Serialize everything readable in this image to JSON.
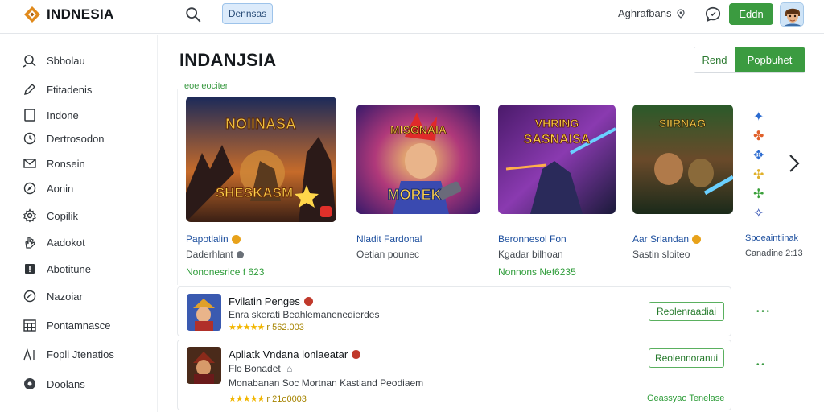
{
  "header": {
    "logo_text": "INDNESIA",
    "tab_label": "Dennsas",
    "user_name": "Aghrafbans",
    "edit_label": "Eddn"
  },
  "sidebar": {
    "items": [
      {
        "label": "Sbbolau",
        "icon": "search-icon"
      },
      {
        "label": "Ftitadenis",
        "icon": "pencil-icon"
      },
      {
        "label": "Indone",
        "icon": "square-icon"
      },
      {
        "label": "Dertrosodon",
        "icon": "clock-icon"
      },
      {
        "label": "Ronsein",
        "icon": "mail-icon"
      },
      {
        "label": "Aonin",
        "icon": "compass-icon"
      },
      {
        "label": "Copilik",
        "icon": "gear-icon"
      },
      {
        "label": "Aadokot",
        "icon": "hand-icon"
      },
      {
        "label": "Abotitune",
        "icon": "alert-icon"
      },
      {
        "label": "Nazoiar",
        "icon": "circle-check-icon"
      },
      {
        "label": "Pontamnasce",
        "icon": "calendar-icon"
      },
      {
        "label": "Fopli Jtenatios",
        "icon": "ai-icon"
      },
      {
        "label": "Doolans",
        "icon": "dot-icon"
      }
    ]
  },
  "main": {
    "title": "INDANJSIA",
    "segment": {
      "left": "Rend",
      "right": "Popbuhet"
    },
    "section_label": "eoe eociter",
    "cards": [
      {
        "art_text_top": "NOIINASA",
        "art_text_bottom": "SHESKASM",
        "title": "Papotlalin",
        "sub": "Daderhlant",
        "meta": "Nononesrice f 623",
        "badge_color": "#e8a21a"
      },
      {
        "art_text_top": "MISGNAIA",
        "art_text_bottom": "MOREK",
        "title": "Nladit Fardonal",
        "sub": "Oetian pounec",
        "meta": "",
        "badge_color": ""
      },
      {
        "art_text_top": "VHRING",
        "art_text_bottom": "SASNAISA",
        "title": "Beronnesol Fon",
        "sub": "Kgadar bilhoan",
        "meta": "Nonnons Nef6235",
        "badge_color": ""
      },
      {
        "art_text_top": "SIIRNAG",
        "art_text_bottom": "",
        "title": "Aar Srlandan",
        "sub": "Sastin sloiteo",
        "meta": "",
        "badge_color": "#e8a21a"
      },
      {
        "art_text_top": "",
        "art_text_bottom": "",
        "title": "Spoeaintlinak",
        "sub": "Canadine 2:13",
        "meta": "",
        "badge_color": ""
      }
    ],
    "list": [
      {
        "title": "Fvilatin Penges",
        "line1": "Enra skerati Beahlemanenedierdes",
        "rating_stars": "★★★★★",
        "rating_text": "r 562.003",
        "button": "Reolenraadiai",
        "extra": ""
      },
      {
        "title": "Apliatk Vndana lonlaeatar",
        "line1": "Flo Bonadet",
        "line2": "Monabanan Soc Mortnan Kastiand Peodiaem",
        "rating_stars": "★★★★★",
        "rating_text": "r 21o0003",
        "button": "Reolennoranui",
        "extra": "Geassyao Tenelase"
      }
    ]
  },
  "colors": {
    "accent_green": "#3b9b40",
    "link_blue": "#1d4f9e",
    "tab_blue": "#dcebfb"
  }
}
